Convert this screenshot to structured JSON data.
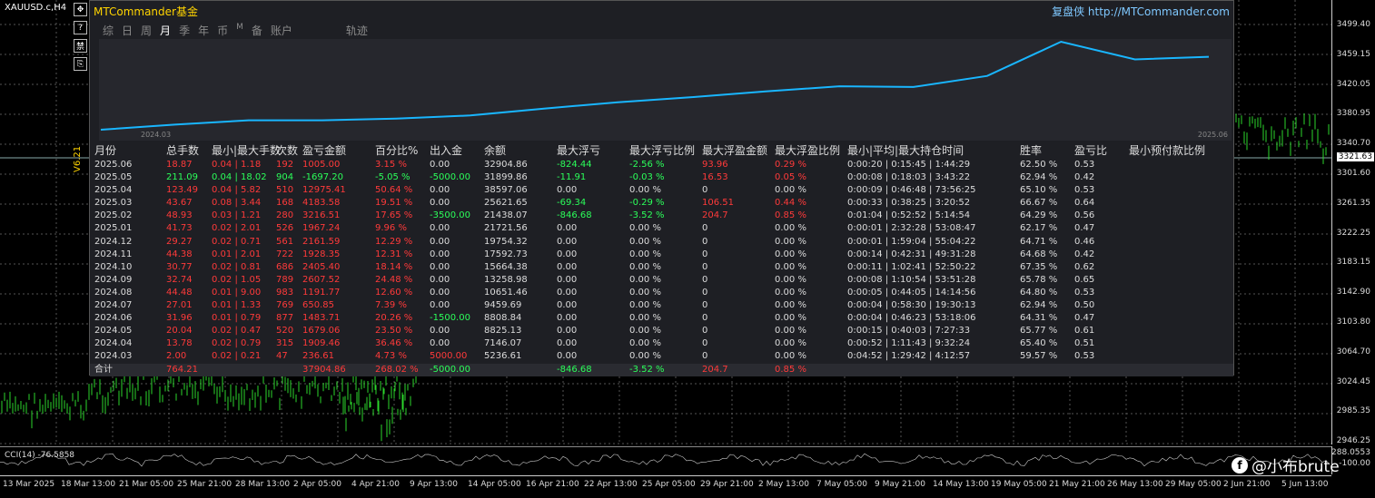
{
  "chart": {
    "symbol": "XAUUSD.c,H4",
    "version_label": "V6.21",
    "current_price": "3321.63",
    "price_labels": [
      "3499.40",
      "3459.15",
      "3420.05",
      "3380.95",
      "3340.70",
      "3301.60",
      "3261.35",
      "3222.25",
      "3183.15",
      "3142.90",
      "3103.80",
      "3064.70",
      "3024.45",
      "2985.35",
      "2946.25"
    ],
    "time_labels": [
      "13 Mar 2025",
      "18 Mar 13:00",
      "21 Mar 05:00",
      "25 Mar 21:00",
      "28 Mar 13:00",
      "2 Apr 05:00",
      "4 Apr 21:00",
      "9 Apr 13:00",
      "14 Apr 05:00",
      "16 Apr 21:00",
      "22 Apr 13:00",
      "25 Apr 05:00",
      "29 Apr 21:00",
      "2 May 13:00",
      "7 May 05:00",
      "9 May 21:00",
      "14 May 13:00",
      "19 May 05:00",
      "21 May 21:00",
      "26 May 13:00",
      "29 May 05:00",
      "2 Jun 21:00",
      "5 Jun 13:00"
    ],
    "indicator_label": "CCI(14) -76.5858",
    "indicator_axis": [
      "288.0553",
      "-100.00"
    ],
    "watermark": "@小布brute"
  },
  "side_tools": [
    "✥",
    "?",
    "禁",
    "⎘"
  ],
  "panel": {
    "title": "MTCommander基金",
    "brand": "复盘侠 http://MTCommander.com",
    "tabs": [
      {
        "label": "综",
        "active": false
      },
      {
        "label": "日",
        "active": false
      },
      {
        "label": "周",
        "active": false
      },
      {
        "label": "月",
        "active": true
      },
      {
        "label": "季",
        "active": false
      },
      {
        "label": "年",
        "active": false
      },
      {
        "label": "币",
        "active": false
      },
      {
        "label": "M",
        "active": false,
        "small": true
      },
      {
        "label": "备",
        "active": false
      },
      {
        "label": "账户",
        "active": false
      },
      {
        "label": "轨迹",
        "active": false,
        "gap": true
      }
    ],
    "equity_start_label": "2024.03",
    "equity_end_label": "2025.06",
    "equity_balance": [
      5236.61,
      7146.07,
      8825.13,
      8808.84,
      9459.69,
      10651.46,
      13258.98,
      15664.38,
      17592.73,
      19754.32,
      21721.56,
      21438.07,
      25621.65,
      38597.06,
      31899.86,
      32904.86
    ]
  },
  "table": {
    "headers": [
      "月份",
      "总手数",
      "最小|最大手数",
      "次数",
      "盈亏金额",
      "百分比%",
      "出入金",
      "余额",
      "最大浮亏",
      "最大浮亏比例",
      "最大浮盈金额",
      "最大浮盈比例",
      "最小|平均|最大持仓时间",
      "胜率",
      "盈亏比",
      "最小预付款比例"
    ],
    "rows": [
      [
        "2025.06",
        "18.87",
        "0.04 | 1.18",
        "192",
        "1005.00",
        "3.15 %",
        "0.00",
        "32904.86",
        "-824.44",
        "-2.56 %",
        "93.96",
        "0.29 %",
        "0:00:20 | 0:15:45 | 1:44:29",
        "62.50 %",
        "0.53"
      ],
      [
        "2025.05",
        "211.09",
        "0.04 | 18.02",
        "904",
        "-1697.20",
        "-5.05 %",
        "-5000.00",
        "31899.86",
        "-11.91",
        "-0.03 %",
        "16.53",
        "0.05 %",
        "0:00:08 | 0:18:03 | 3:43:22",
        "62.94 %",
        "0.42"
      ],
      [
        "2025.04",
        "123.49",
        "0.04 | 5.82",
        "510",
        "12975.41",
        "50.64 %",
        "0.00",
        "38597.06",
        "0.00",
        "0.00 %",
        "0",
        "0.00 %",
        "0:00:09 | 0:46:48 | 73:56:25",
        "65.10 %",
        "0.53"
      ],
      [
        "2025.03",
        "43.67",
        "0.08 | 3.44",
        "168",
        "4183.58",
        "19.51 %",
        "0.00",
        "25621.65",
        "-69.34",
        "-0.29 %",
        "106.51",
        "0.44 %",
        "0:00:33 | 0:38:25 | 3:20:52",
        "66.67 %",
        "0.64"
      ],
      [
        "2025.02",
        "48.93",
        "0.03 | 1.21",
        "280",
        "3216.51",
        "17.65 %",
        "-3500.00",
        "21438.07",
        "-846.68",
        "-3.52 %",
        "204.7",
        "0.85 %",
        "0:01:04 | 0:52:52 | 5:14:54",
        "64.29 %",
        "0.56"
      ],
      [
        "2025.01",
        "41.73",
        "0.02 | 2.01",
        "526",
        "1967.24",
        "9.96 %",
        "0.00",
        "21721.56",
        "0.00",
        "0.00 %",
        "0",
        "0.00 %",
        "0:00:01 | 2:32:28 | 53:08:47",
        "62.17 %",
        "0.47"
      ],
      [
        "2024.12",
        "29.27",
        "0.02 | 0.71",
        "561",
        "2161.59",
        "12.29 %",
        "0.00",
        "19754.32",
        "0.00",
        "0.00 %",
        "0",
        "0.00 %",
        "0:00:01 | 1:59:04 | 55:04:22",
        "64.71 %",
        "0.46"
      ],
      [
        "2024.11",
        "44.38",
        "0.01 | 2.01",
        "722",
        "1928.35",
        "12.31 %",
        "0.00",
        "17592.73",
        "0.00",
        "0.00 %",
        "0",
        "0.00 %",
        "0:00:14 | 0:42:31 | 49:31:28",
        "64.68 %",
        "0.42"
      ],
      [
        "2024.10",
        "30.77",
        "0.02 | 0.81",
        "686",
        "2405.40",
        "18.14 %",
        "0.00",
        "15664.38",
        "0.00",
        "0.00 %",
        "0",
        "0.00 %",
        "0:00:11 | 1:02:41 | 52:50:22",
        "67.35 %",
        "0.62"
      ],
      [
        "2024.09",
        "32.74",
        "0.02 | 1.05",
        "789",
        "2607.52",
        "24.48 %",
        "0.00",
        "13258.98",
        "0.00",
        "0.00 %",
        "0",
        "0.00 %",
        "0:00:08 | 1:10:54 | 53:51:28",
        "65.78 %",
        "0.65"
      ],
      [
        "2024.08",
        "44.48",
        "0.01 | 9.00",
        "983",
        "1191.77",
        "12.60 %",
        "0.00",
        "10651.46",
        "0.00",
        "0.00 %",
        "0",
        "0.00 %",
        "0:00:05 | 0:44:05 | 14:14:56",
        "64.80 %",
        "0.53"
      ],
      [
        "2024.07",
        "27.01",
        "0.01 | 1.33",
        "769",
        "650.85",
        "7.39 %",
        "0.00",
        "9459.69",
        "0.00",
        "0.00 %",
        "0",
        "0.00 %",
        "0:00:04 | 0:58:30 | 19:30:13",
        "62.94 %",
        "0.50"
      ],
      [
        "2024.06",
        "31.96",
        "0.01 | 0.79",
        "877",
        "1483.71",
        "20.26 %",
        "-1500.00",
        "8808.84",
        "0.00",
        "0.00 %",
        "0",
        "0.00 %",
        "0:00:04 | 0:46:23 | 53:18:06",
        "64.31 %",
        "0.47"
      ],
      [
        "2024.05",
        "20.04",
        "0.02 | 0.47",
        "520",
        "1679.06",
        "23.50 %",
        "0.00",
        "8825.13",
        "0.00",
        "0.00 %",
        "0",
        "0.00 %",
        "0:00:15 | 0:40:03 | 7:27:33",
        "65.77 %",
        "0.61"
      ],
      [
        "2024.04",
        "13.78",
        "0.02 | 0.79",
        "315",
        "1909.46",
        "36.46 %",
        "0.00",
        "7146.07",
        "0.00",
        "0.00 %",
        "0",
        "0.00 %",
        "0:00:52 | 1:11:43 | 9:32:24",
        "65.40 %",
        "0.51"
      ],
      [
        "2024.03",
        "2.00",
        "0.02 | 0.21",
        "47",
        "236.61",
        "4.73 %",
        "5000.00",
        "5236.61",
        "0.00",
        "0.00 %",
        "0",
        "0.00 %",
        "0:04:52 | 1:29:42 | 4:12:57",
        "59.57 %",
        "0.53"
      ]
    ],
    "total": {
      "label": "合计",
      "lots": "764.21",
      "profit": "37904.86",
      "pct": "268.02 %",
      "flow": "-5000.00",
      "max_dd": "-846.68",
      "max_dd_pct": "-3.52 %",
      "max_fp": "204.7",
      "max_fp_pct": "0.85 %"
    },
    "colors": {
      "red": "#ff3a3a",
      "green": "#2bff5a",
      "white": "#dcdcdc",
      "equity_line": "#19b6ff"
    }
  }
}
